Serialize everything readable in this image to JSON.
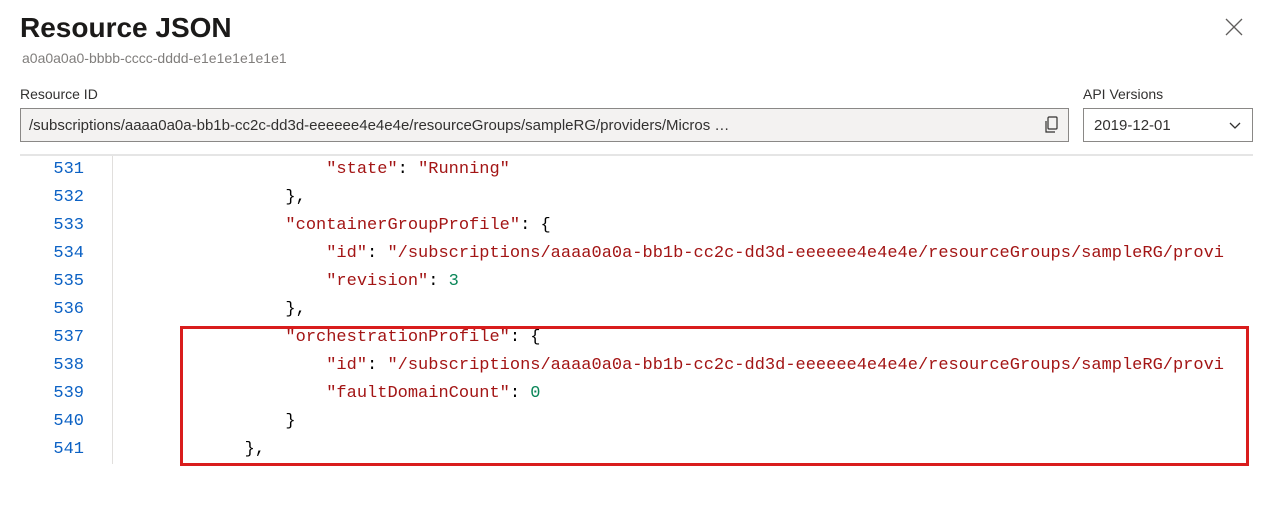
{
  "header": {
    "title": "Resource JSON",
    "subtitle": "a0a0a0a0-bbbb-cccc-dddd-e1e1e1e1e1e1"
  },
  "fields": {
    "resource_id_label": "Resource ID",
    "resource_id_value": "/subscriptions/aaaa0a0a-bb1b-cc2c-dd3d-eeeeee4e4e4e/resourceGroups/sampleRG/providers/Micros …",
    "api_versions_label": "API Versions",
    "api_version_selected": "2019-12-01"
  },
  "code": {
    "lines": [
      {
        "num": "531",
        "indent": "                ",
        "tokens": [
          [
            "s",
            "\"state\""
          ],
          [
            "p",
            ": "
          ],
          [
            "s",
            "\"Running\""
          ]
        ]
      },
      {
        "num": "532",
        "indent": "            ",
        "tokens": [
          [
            "p",
            "},"
          ]
        ]
      },
      {
        "num": "533",
        "indent": "            ",
        "tokens": [
          [
            "s",
            "\"containerGroupProfile\""
          ],
          [
            "p",
            ": {"
          ]
        ]
      },
      {
        "num": "534",
        "indent": "                ",
        "tokens": [
          [
            "s",
            "\"id\""
          ],
          [
            "p",
            ": "
          ],
          [
            "s",
            "\"/subscriptions/aaaa0a0a-bb1b-cc2c-dd3d-eeeeee4e4e4e/resourceGroups/sampleRG/provi"
          ]
        ]
      },
      {
        "num": "535",
        "indent": "                ",
        "tokens": [
          [
            "s",
            "\"revision\""
          ],
          [
            "p",
            ": "
          ],
          [
            "n",
            "3"
          ]
        ]
      },
      {
        "num": "536",
        "indent": "            ",
        "tokens": [
          [
            "p",
            "},"
          ]
        ]
      },
      {
        "num": "537",
        "indent": "            ",
        "tokens": [
          [
            "s",
            "\"orchestrationProfile\""
          ],
          [
            "p",
            ": {"
          ]
        ]
      },
      {
        "num": "538",
        "indent": "                ",
        "tokens": [
          [
            "s",
            "\"id\""
          ],
          [
            "p",
            ": "
          ],
          [
            "s",
            "\"/subscriptions/aaaa0a0a-bb1b-cc2c-dd3d-eeeeee4e4e4e/resourceGroups/sampleRG/provi"
          ]
        ]
      },
      {
        "num": "539",
        "indent": "                ",
        "tokens": [
          [
            "s",
            "\"faultDomainCount\""
          ],
          [
            "p",
            ": "
          ],
          [
            "n",
            "0"
          ]
        ]
      },
      {
        "num": "540",
        "indent": "            ",
        "tokens": [
          [
            "p",
            "}"
          ]
        ]
      },
      {
        "num": "541",
        "indent": "        ",
        "tokens": [
          [
            "p",
            "},"
          ]
        ]
      }
    ]
  }
}
